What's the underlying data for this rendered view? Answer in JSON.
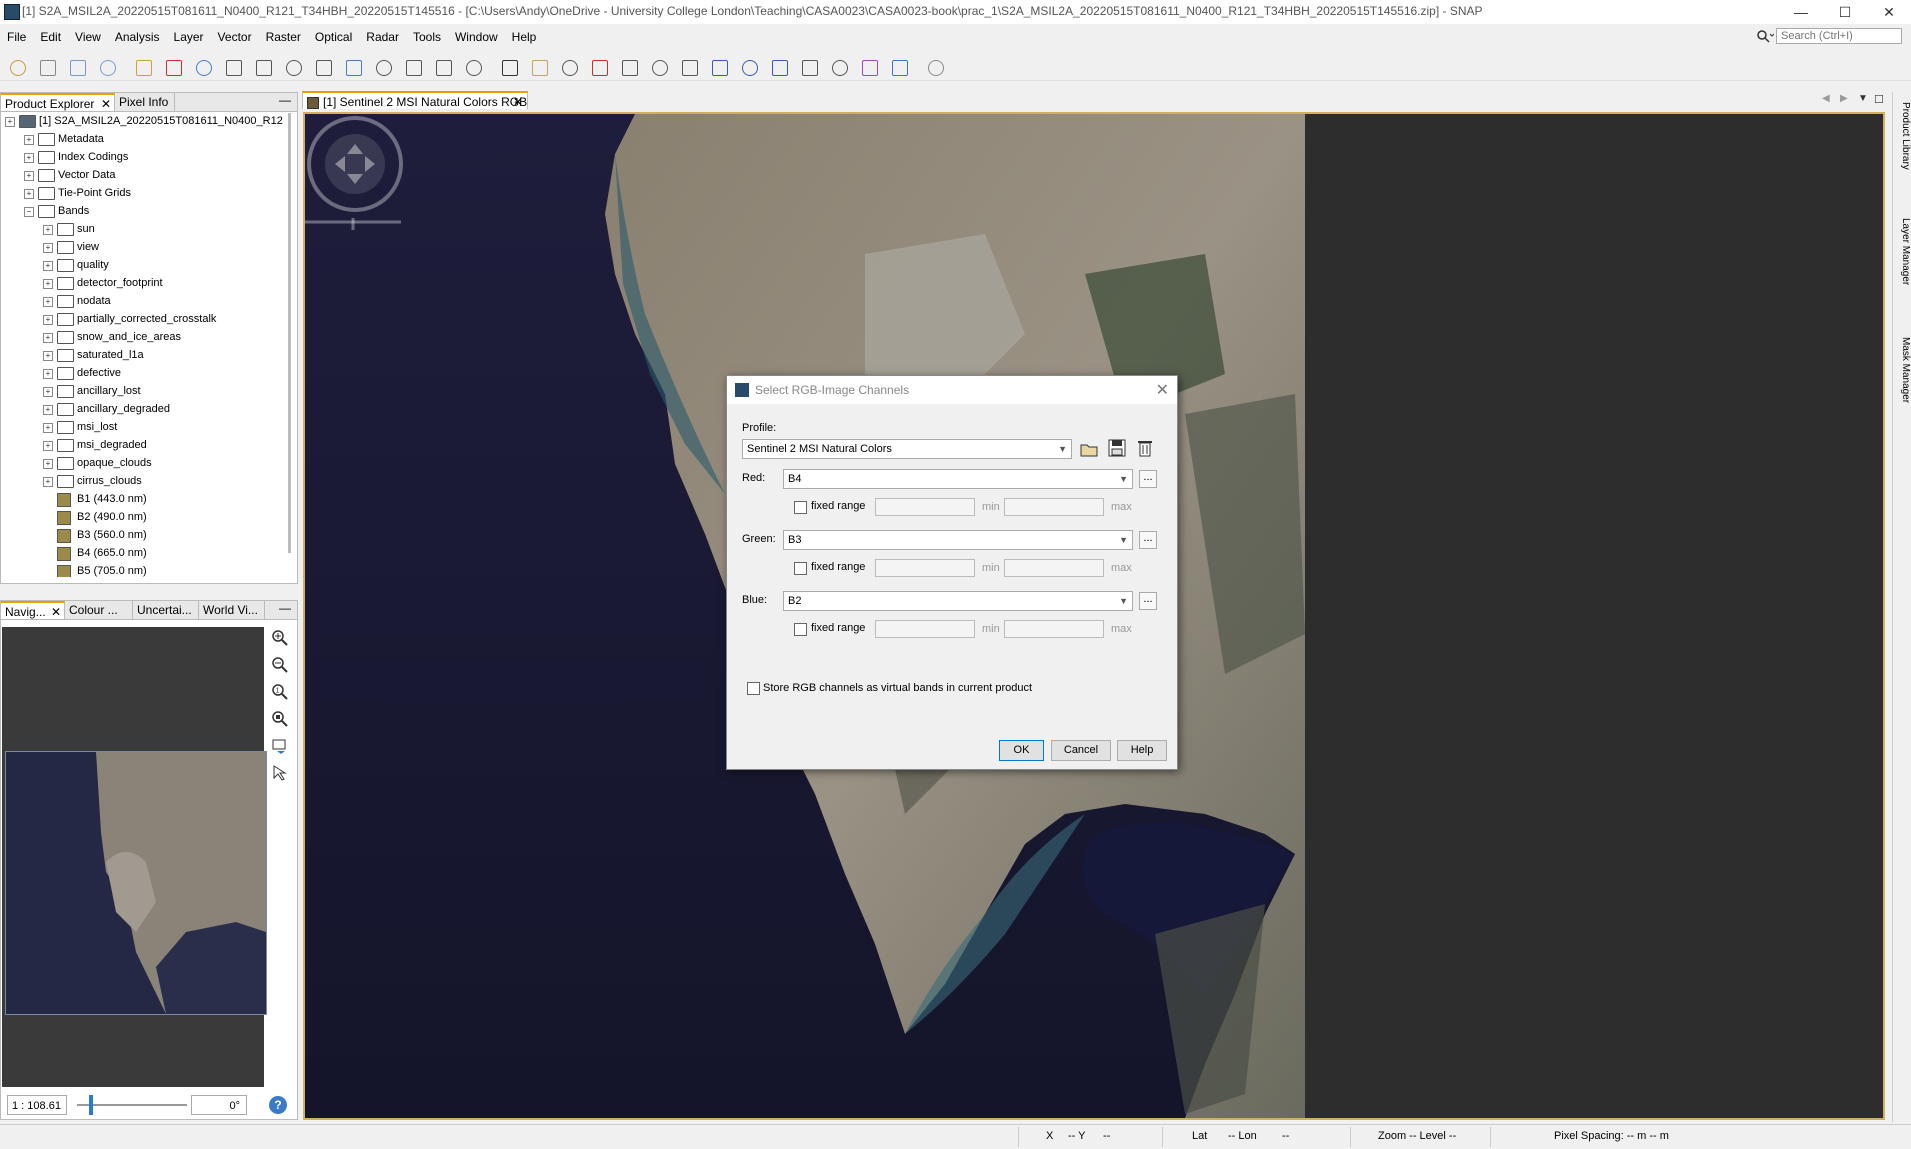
{
  "window": {
    "title": "[1] S2A_MSIL2A_20220515T081611_N0400_R121_T34HBH_20220515T145516 - [C:\\Users\\Andy\\OneDrive - University College London\\Teaching\\CASA0023\\CASA0023-book\\prac_1\\S2A_MSIL2A_20220515T081611_N0400_R121_T34HBH_20220515T145516.zip] - SNAP",
    "minimize": "—",
    "maximize": "☐",
    "close": "✕"
  },
  "menu": [
    "File",
    "Edit",
    "View",
    "Analysis",
    "Layer",
    "Vector",
    "Raster",
    "Optical",
    "Radar",
    "Tools",
    "Window",
    "Help"
  ],
  "search": {
    "placeholder": "Search (Ctrl+I)"
  },
  "left_panel": {
    "tabs": [
      {
        "label": "Product Explorer"
      },
      {
        "label": "Pixel Info"
      }
    ],
    "tree": [
      {
        "label": "[1] S2A_MSIL2A_20220515T081611_N0400_R121",
        "level": 0,
        "kind": "product"
      },
      {
        "label": "Metadata",
        "level": 1,
        "kind": "folder"
      },
      {
        "label": "Index Codings",
        "level": 1,
        "kind": "folder"
      },
      {
        "label": "Vector Data",
        "level": 1,
        "kind": "folder"
      },
      {
        "label": "Tie-Point Grids",
        "level": 1,
        "kind": "folder"
      },
      {
        "label": "Bands",
        "level": 1,
        "kind": "folder-open"
      },
      {
        "label": "sun",
        "level": 2,
        "kind": "folder"
      },
      {
        "label": "view",
        "level": 2,
        "kind": "folder"
      },
      {
        "label": "quality",
        "level": 2,
        "kind": "folder"
      },
      {
        "label": "detector_footprint",
        "level": 2,
        "kind": "folder"
      },
      {
        "label": "nodata",
        "level": 2,
        "kind": "folder"
      },
      {
        "label": "partially_corrected_crosstalk",
        "level": 2,
        "kind": "folder"
      },
      {
        "label": "snow_and_ice_areas",
        "level": 2,
        "kind": "folder"
      },
      {
        "label": "saturated_l1a",
        "level": 2,
        "kind": "folder"
      },
      {
        "label": "defective",
        "level": 2,
        "kind": "folder"
      },
      {
        "label": "ancillary_lost",
        "level": 2,
        "kind": "folder"
      },
      {
        "label": "ancillary_degraded",
        "level": 2,
        "kind": "folder"
      },
      {
        "label": "msi_lost",
        "level": 2,
        "kind": "folder"
      },
      {
        "label": "msi_degraded",
        "level": 2,
        "kind": "folder"
      },
      {
        "label": "opaque_clouds",
        "level": 2,
        "kind": "folder"
      },
      {
        "label": "cirrus_clouds",
        "level": 2,
        "kind": "folder"
      },
      {
        "label": "B1 (443.0 nm)",
        "level": 2,
        "kind": "band"
      },
      {
        "label": "B2 (490.0 nm)",
        "level": 2,
        "kind": "band"
      },
      {
        "label": "B3 (560.0 nm)",
        "level": 2,
        "kind": "band"
      },
      {
        "label": "B4 (665.0 nm)",
        "level": 2,
        "kind": "band"
      },
      {
        "label": "B5 (705.0 nm)",
        "level": 2,
        "kind": "band"
      }
    ]
  },
  "nav_panel": {
    "tabs": [
      {
        "label": "Navig..."
      },
      {
        "label": "Colour ..."
      },
      {
        "label": "Uncertai..."
      },
      {
        "label": "World Vi..."
      }
    ],
    "scale": "1 : 108.61",
    "angle": "0°",
    "help": "?"
  },
  "document": {
    "tab": "[1] Sentinel 2 MSI Natural Colors RGB"
  },
  "right_strip": {
    "tabs": [
      "Product Library",
      "Layer Manager",
      "Mask Manager"
    ]
  },
  "statusbar": {
    "x": "X",
    "x_val": "-- Y",
    "y_val": "--",
    "lat": "Lat",
    "lat_val": "-- Lon",
    "lon_val": "--",
    "zoom": "Zoom -- Level --",
    "spacing": "Pixel Spacing: -- m -- m"
  },
  "dialog": {
    "title": "Select RGB-Image Channels",
    "profile_label": "Profile:",
    "profile_value": "Sentinel 2 MSI Natural Colors",
    "channels": [
      {
        "label": "Red:",
        "value": "B4"
      },
      {
        "label": "Green:",
        "value": "B3"
      },
      {
        "label": "Blue:",
        "value": "B2"
      }
    ],
    "fixed_range_label": "fixed range",
    "min_label": "min",
    "max_label": "max",
    "store_label": "Store RGB channels as virtual bands in current product",
    "ok": "OK",
    "cancel": "Cancel",
    "help": "Help"
  }
}
